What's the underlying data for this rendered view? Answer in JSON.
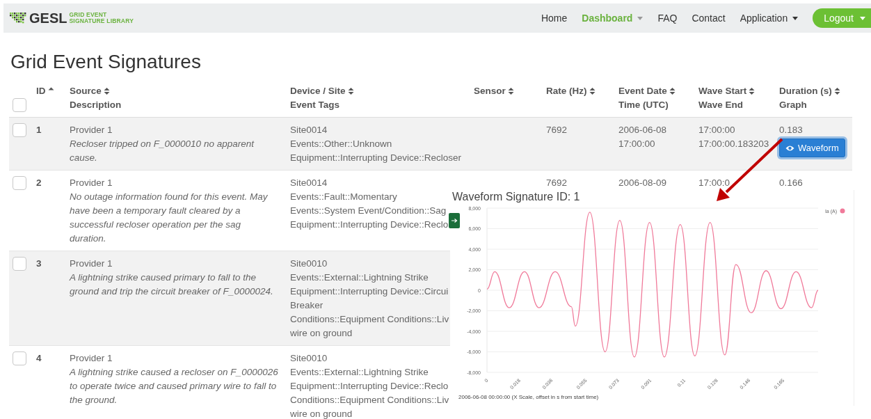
{
  "navbar": {
    "brand": {
      "name": "GESL",
      "tagline_lines": [
        "GRID EVENT",
        "SIGNATURE LIBRARY"
      ]
    },
    "items": [
      {
        "label": "Home",
        "selected": false,
        "dropdown": false,
        "kind": "link"
      },
      {
        "label": "Dashboard",
        "selected": true,
        "dropdown": true,
        "kind": "link"
      },
      {
        "label": "FAQ",
        "selected": false,
        "dropdown": false,
        "kind": "link"
      },
      {
        "label": "Contact",
        "selected": false,
        "dropdown": false,
        "kind": "link"
      },
      {
        "label": "Application",
        "selected": false,
        "dropdown": true,
        "kind": "link"
      },
      {
        "label": "Logout",
        "selected": false,
        "dropdown": true,
        "kind": "button"
      }
    ]
  },
  "page_title": "Grid Event Signatures",
  "table": {
    "select_all": {
      "checked": false
    },
    "columns": [
      {
        "lines": [
          "ID"
        ],
        "sorted": true
      },
      {
        "lines": [
          "Source",
          "Description"
        ],
        "sorted": false
      },
      {
        "lines": [
          "Device / Site",
          "Event Tags"
        ],
        "sorted": false
      },
      {
        "lines": [
          "Sensor"
        ],
        "sorted": false
      },
      {
        "lines": [
          "Rate (Hz)"
        ],
        "sorted": false
      },
      {
        "lines": [
          "Event Date",
          "Time (UTC)"
        ],
        "sorted": false
      },
      {
        "lines": [
          "Wave Start",
          "Wave End"
        ],
        "sorted": false
      },
      {
        "lines": [
          "Duration (s)",
          "Graph"
        ],
        "sorted": false
      }
    ],
    "rows": [
      {
        "checked": false,
        "id": "1",
        "source": "Provider 1",
        "description": "Recloser tripped on F_0000010 no apparent cause.",
        "device_lines": [
          "Site0014",
          "Events::Other::Unknown",
          "Equipment::Interrupting Device::Recloser"
        ],
        "rate": "7692",
        "date_lines": [
          "2006-06-08",
          "17:00:00"
        ],
        "wave_lines": [
          "17:00:00",
          "17:00:00.183203"
        ],
        "duration": "0.183",
        "graph_button": {
          "label": "Waveform",
          "focused": true
        }
      },
      {
        "checked": false,
        "id": "2",
        "source": "Provider 1",
        "description": "No outage information found for this event. May have been a temporary fault cleared by a successful recloser operation per the sag duration.",
        "device_lines": [
          "Site0014",
          "Events::Fault::Momentary",
          "Events::System Event/Condition::Sag",
          "Equipment::Interrupting Device::Reclo"
        ],
        "rate": "7692",
        "date_lines": [
          "2006-08-09"
        ],
        "wave_lines": [
          "17:00:0"
        ],
        "duration": "0.166"
      },
      {
        "checked": false,
        "id": "3",
        "source": "Provider 1",
        "description": "A lightning strike caused primary to fall to the ground and trip the circuit breaker of F_0000024.",
        "device_lines": [
          "Site0010",
          "Events::External::Lightning Strike",
          "Equipment::Interrupting Device::Circui",
          "Breaker",
          "Conditions::Equipment Conditions::Liv",
          "wire on ground"
        ]
      },
      {
        "checked": false,
        "id": "4",
        "source": "Provider 1",
        "description": "A lightning strike caused a recloser on F_0000026 to operate twice and caused primary wire to fall to the ground.",
        "device_lines": [
          "Site0010",
          "Events::External::Lightning Strike",
          "Equipment::Interrupting Device::Reclo",
          "Conditions::Equipment Conditions::Liv",
          "wire on ground"
        ]
      }
    ]
  },
  "waveform_popup": {
    "title": "Waveform Signature ID: 1",
    "chart_data": {
      "type": "line",
      "grid": true,
      "xlabel": "2006-06-08 00:00:00 (X Scale, offset in s from start time)",
      "x": [
        0,
        0.0043,
        0.0124,
        0.0209,
        0.029,
        0.038,
        0.047,
        0.0492,
        0.0573,
        0.0658,
        0.074,
        0.0821,
        0.0906,
        0.0988,
        0.1077,
        0.1158,
        0.1243,
        0.1325,
        0.1387,
        0.1472,
        0.1555,
        0.1638,
        0.1722,
        0.1808,
        0.1845
      ],
      "series": [
        {
          "name": "Ia (A)",
          "color": "#f07a9a",
          "values": [
            100,
            1800,
            -1700,
            1800,
            -1700,
            1800,
            -1600,
            -3500,
            7600,
            -6000,
            6800,
            -6500,
            6600,
            -6500,
            6400,
            -6400,
            6600,
            -6300,
            2500,
            -2200,
            1900,
            -1800,
            1800,
            -1700,
            0
          ]
        }
      ],
      "xlim": [
        0,
        0.1845
      ],
      "ylim": [
        -8000,
        8000
      ],
      "xticks": [
        0,
        0.018,
        0.036,
        0.055,
        0.073,
        0.091,
        0.11,
        0.128,
        0.146,
        0.165
      ],
      "yticks": [
        {
          "value": 8000,
          "label": "8,000"
        },
        {
          "value": 6000,
          "label": "6,000"
        },
        {
          "value": 4000,
          "label": "4,000"
        },
        {
          "value": 2000,
          "label": "2,000"
        },
        {
          "value": 0,
          "label": "0"
        },
        {
          "value": -2000,
          "label": "-2,000"
        },
        {
          "value": -4000,
          "label": "-4,000"
        },
        {
          "value": -6000,
          "label": "-6,000"
        },
        {
          "value": -8000,
          "label": "-8,000"
        }
      ]
    }
  }
}
